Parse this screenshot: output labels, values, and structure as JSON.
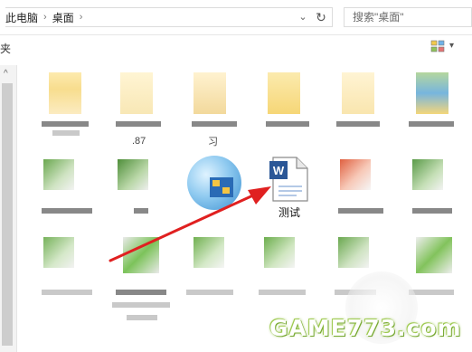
{
  "address": {
    "breadcrumbs": [
      "此电脑",
      "桌面"
    ],
    "separator": "›",
    "dropdown_glyph": "⌄",
    "refresh_glyph": "↻",
    "search_placeholder": "搜索\"桌面\""
  },
  "toolbar": {
    "left_text": "夹",
    "view_icon": "large-icons-view-icon",
    "view_dropdown_glyph": "▾"
  },
  "nav": {
    "scroll_up_glyph": "^"
  },
  "files": {
    "visible_labels": [
      ".87",
      "习"
    ],
    "word_document": {
      "icon_letter": "W",
      "label": "测试"
    }
  },
  "arrow_color": "#e02020",
  "watermark": {
    "text": "GAME773.com"
  }
}
